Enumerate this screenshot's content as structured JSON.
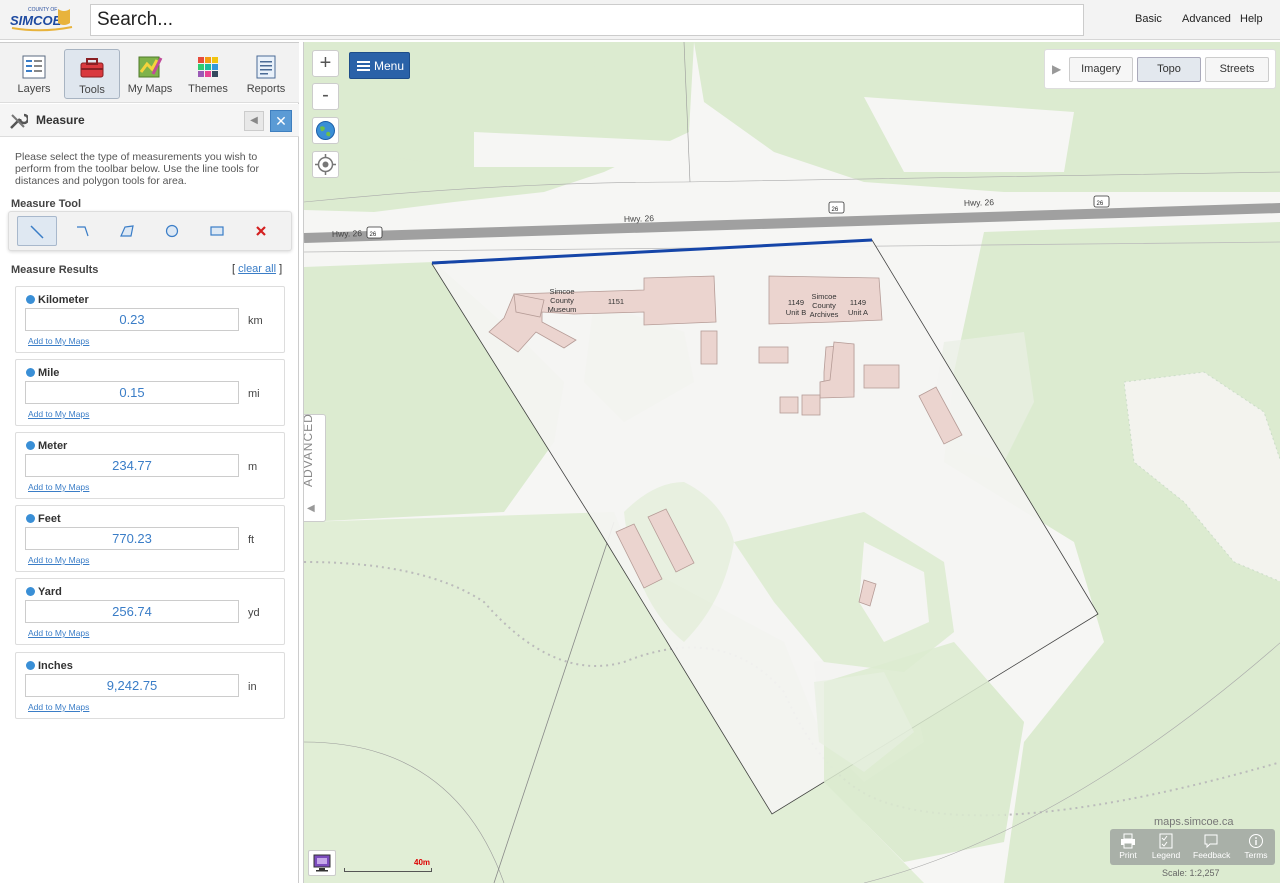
{
  "header": {
    "logo_text": "SIMCOE",
    "logo_subtext": "COUNTY OF",
    "search_placeholder": "Search...",
    "links": [
      "Basic",
      "Advanced",
      "Help"
    ]
  },
  "sidebar": {
    "tabs": [
      {
        "label": "Layers",
        "icon": "layers-icon"
      },
      {
        "label": "Tools",
        "icon": "toolbox-icon",
        "active": true
      },
      {
        "label": "My Maps",
        "icon": "my-maps-icon"
      },
      {
        "label": "Themes",
        "icon": "themes-icon"
      },
      {
        "label": "Reports",
        "icon": "reports-icon"
      }
    ],
    "panel_title": "Measure",
    "instructions": "Please select the type of measurements you wish to perform from the toolbar below. Use the line tools for distances and polygon tools for area.",
    "measure_tool_label": "Measure Tool",
    "measure_tools": [
      {
        "name": "line-tool",
        "active": true
      },
      {
        "name": "polyline-tool"
      },
      {
        "name": "polygon-tool"
      },
      {
        "name": "circle-tool"
      },
      {
        "name": "rectangle-tool"
      },
      {
        "name": "clear-tool"
      }
    ],
    "measure_results_label": "Measure Results",
    "clear_all_open": "[",
    "clear_all_link": "clear all",
    "clear_all_close": "]",
    "results": [
      {
        "label": "Kilometer",
        "value": "0.23",
        "unit": "km",
        "link": "Add to My Maps"
      },
      {
        "label": "Mile",
        "value": "0.15",
        "unit": "mi",
        "link": "Add to My Maps"
      },
      {
        "label": "Meter",
        "value": "234.77",
        "unit": "m",
        "link": "Add to My Maps"
      },
      {
        "label": "Feet",
        "value": "770.23",
        "unit": "ft",
        "link": "Add to My Maps"
      },
      {
        "label": "Yard",
        "value": "256.74",
        "unit": "yd",
        "link": "Add to My Maps"
      },
      {
        "label": "Inches",
        "value": "9,242.75",
        "unit": "in",
        "link": "Add to My Maps"
      }
    ]
  },
  "map": {
    "zoom_in": "+",
    "zoom_out": "-",
    "menu_label": "Menu",
    "basemaps": [
      "Imagery",
      "Topo",
      "Streets"
    ],
    "active_basemap": "Topo",
    "advanced_label": "ADVANCED",
    "road_labels": [
      "Hwy. 26",
      "Hwy. 26",
      "Hwy. 26"
    ],
    "shield_numbers": [
      "26",
      "26",
      "26"
    ],
    "building_labels": {
      "museum": [
        "Simcoe",
        "County",
        "Museum"
      ],
      "museum_number": "1151",
      "archives": [
        "Simcoe",
        "County",
        "Archives"
      ],
      "unit_b": [
        "1149",
        "Unit B"
      ],
      "unit_a": [
        "1149",
        "Unit A"
      ]
    },
    "scale_label": "40m",
    "watermark": "maps.simcoe.ca",
    "footer_tools": [
      {
        "label": "Print",
        "icon": "print-icon"
      },
      {
        "label": "Legend",
        "icon": "legend-icon"
      },
      {
        "label": "Feedback",
        "icon": "feedback-icon"
      },
      {
        "label": "Terms",
        "icon": "info-icon"
      }
    ],
    "scale_text": "Scale: 1:2,257",
    "measure_line_color": "#1545a8"
  }
}
